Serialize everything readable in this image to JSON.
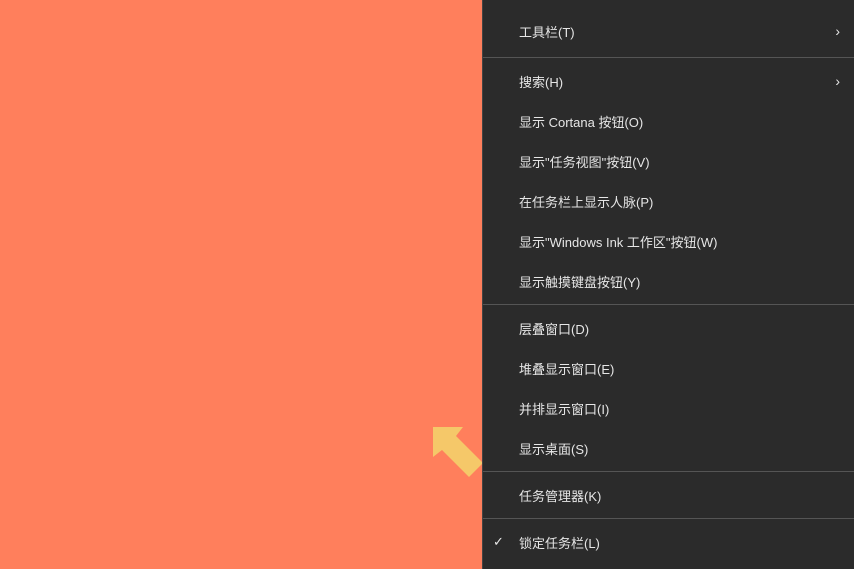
{
  "menu": {
    "items": [
      {
        "label": "工具栏(T)",
        "hasSubmenu": true
      },
      {
        "label": "搜索(H)",
        "hasSubmenu": true
      },
      {
        "label": "显示 Cortana 按钮(O)"
      },
      {
        "label": "显示\"任务视图\"按钮(V)"
      },
      {
        "label": "在任务栏上显示人脉(P)"
      },
      {
        "label": "显示\"Windows Ink 工作区\"按钮(W)"
      },
      {
        "label": "显示触摸键盘按钮(Y)"
      },
      {
        "label": "层叠窗口(D)"
      },
      {
        "label": "堆叠显示窗口(E)"
      },
      {
        "label": "并排显示窗口(I)"
      },
      {
        "label": "显示桌面(S)"
      },
      {
        "label": "任务管理器(K)"
      },
      {
        "label": "锁定任务栏(L)",
        "checked": true
      }
    ]
  }
}
